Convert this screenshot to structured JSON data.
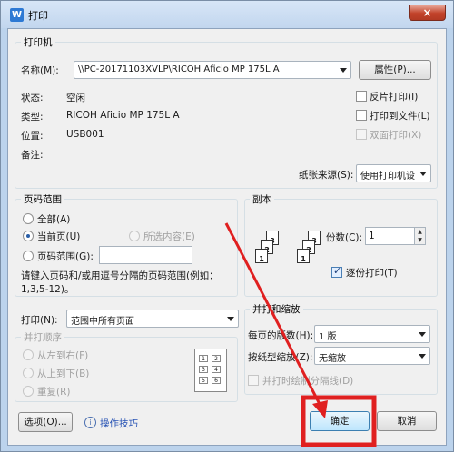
{
  "window": {
    "title": "打印",
    "app_icon": "W",
    "close_icon": "×"
  },
  "printer": {
    "legend": "打印机",
    "name_label": "名称(M):",
    "name_value": "\\\\PC-20171103XVLP\\RICOH Aficio MP 175L A",
    "properties_label": "属性(P)...",
    "status_label": "状态:",
    "status_value": "空闲",
    "type_label": "类型:",
    "type_value": "RICOH Aficio MP 175L A",
    "location_label": "位置:",
    "location_value": "USB001",
    "comment_label": "备注:",
    "reverse_label": "反片打印(I)",
    "tofile_label": "打印到文件(L)",
    "duplex_label": "双面打印(X)",
    "paper_source_label": "纸张来源(S):",
    "paper_source_value": "使用打印机设"
  },
  "range": {
    "legend": "页码范围",
    "all_label": "全部(A)",
    "current_label": "当前页(U)",
    "selection_label": "所选内容(E)",
    "pages_label": "页码范围(G):",
    "pages_value": "",
    "hint": "请键入页码和/或用逗号分隔的页码范围(例如：1,3,5-12)。"
  },
  "copies": {
    "legend": "副本",
    "count_label": "份数(C):",
    "count_value": "1",
    "collate_label": "逐份打印(T)",
    "pages_a": [
      "3",
      "2",
      "1"
    ],
    "pages_b": [
      "3",
      "2",
      "1"
    ]
  },
  "print_what": {
    "label": "打印(N):",
    "value": "范围中所有页面"
  },
  "order": {
    "legend": "并打顺序",
    "ltr_label": "从左到右(F)",
    "ttb_label": "从上到下(B)",
    "repeat_label": "重复(R)",
    "grid": [
      "1",
      "2",
      "3",
      "4",
      "5",
      "6"
    ]
  },
  "zoom": {
    "legend": "并打和缩放",
    "per_sheet_label": "每页的版数(H):",
    "per_sheet_value": "1 版",
    "scale_label": "按纸型缩放(Z):",
    "scale_value": "无缩放",
    "divider_label": "并打时绘制分隔线(D)"
  },
  "footer": {
    "options_label": "选项(O)...",
    "tips_label": "操作技巧",
    "ok_label": "确定",
    "cancel_label": "取消"
  },
  "colors": {
    "annotation_red": "#e02020",
    "accent": "#2a5fa8"
  }
}
